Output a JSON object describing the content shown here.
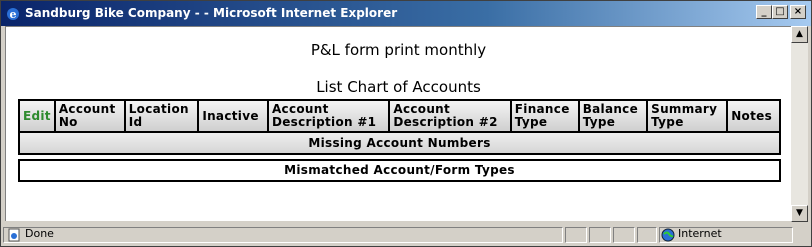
{
  "window": {
    "title": "Sandburg Bike Company - - Microsoft Internet Explorer",
    "controls": {
      "minimize": "_",
      "maximize": "□",
      "close": "×"
    }
  },
  "page": {
    "title": "P&L form print monthly",
    "section_title": "List Chart of Accounts"
  },
  "table": {
    "headers": [
      {
        "line1": "Edit",
        "line2": ""
      },
      {
        "line1": "Account",
        "line2": "No"
      },
      {
        "line1": "Location",
        "line2": "Id"
      },
      {
        "line1": "Inactive",
        "line2": ""
      },
      {
        "line1": "Account",
        "line2": "Description #1"
      },
      {
        "line1": "Account",
        "line2": "Description #2"
      },
      {
        "line1": "Finance",
        "line2": "Type"
      },
      {
        "line1": "Balance",
        "line2": "Type"
      },
      {
        "line1": "Summary",
        "line2": "Type"
      },
      {
        "line1": "Notes",
        "line2": ""
      }
    ],
    "missing_row": "Missing Account Numbers"
  },
  "mismatch": "Mismatched Account/Form Types",
  "statusbar": {
    "status": "Done",
    "zone": "Internet"
  },
  "colors": {
    "edit_link": "#2e8b2e",
    "titlebar": "#0a246a"
  },
  "icons": [
    "ie-icon",
    "scroll-up-icon",
    "scroll-down-icon",
    "page-icon",
    "globe-icon"
  ]
}
